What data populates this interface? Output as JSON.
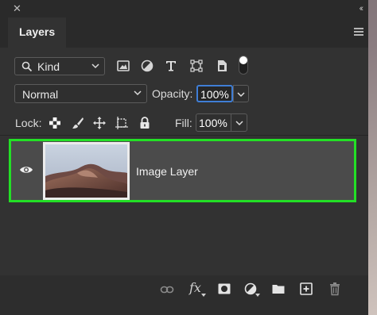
{
  "panel": {
    "tab_label": "Layers"
  },
  "filter": {
    "kind_label": "Kind",
    "icons": [
      "pixel-layer-filter-icon",
      "adjustment-layer-filter-icon",
      "type-layer-filter-icon",
      "shape-layer-filter-icon",
      "smart-object-filter-icon"
    ],
    "filter_toggle_on": true
  },
  "blend": {
    "mode": "Normal",
    "opacity_label": "Opacity:",
    "opacity_value": "100%"
  },
  "lock": {
    "label": "Lock:",
    "fill_label": "Fill:",
    "fill_value": "100%"
  },
  "layers": [
    {
      "name": "Image Layer",
      "visible": true,
      "selected": true
    }
  ],
  "footer": {
    "icons": [
      "link-layers-icon",
      "fx-layer-style-icon",
      "add-mask-icon",
      "adjustment-layer-icon",
      "new-group-icon",
      "new-layer-icon",
      "delete-layer-icon"
    ],
    "fx_label": "fx"
  },
  "colors": {
    "panel_bg": "#323232",
    "selected_row": "#4b4b4b",
    "highlight_outline": "#23e026",
    "focus_blue": "#3f7ed6"
  }
}
